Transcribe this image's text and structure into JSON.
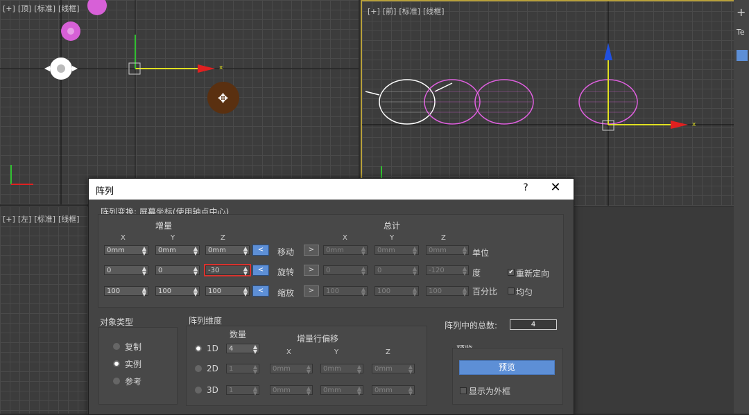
{
  "viewports": {
    "top_left": {
      "labels": [
        "[+]",
        "[顶]",
        "[标准]",
        "[线框]"
      ]
    },
    "top_right": {
      "labels": [
        "[+]",
        "[前]",
        "[标准]",
        "[线框]"
      ]
    },
    "bottom_left": {
      "labels": [
        "[+]",
        "[左]",
        "[标准]",
        "[线框]"
      ]
    }
  },
  "sidebar": {
    "text": "Te"
  },
  "dialog": {
    "title": "阵列",
    "help_label": "?",
    "close_label": "✕",
    "transform_label": "阵列变换: 屏幕坐标(使用轴点中心)",
    "increment_header": "增量",
    "total_header": "总计",
    "axes": [
      "X",
      "Y",
      "Z"
    ],
    "rows": [
      {
        "label": "移动",
        "unit": "单位",
        "inc": [
          "0mm",
          "0mm",
          "0mm"
        ],
        "tot": [
          "0mm",
          "0mm",
          "0mm"
        ]
      },
      {
        "label": "旋转",
        "unit": "度",
        "inc": [
          "0",
          "0",
          "-30"
        ],
        "tot": [
          "0",
          "0",
          "-120"
        ]
      },
      {
        "label": "缩放",
        "unit": "百分比",
        "inc": [
          "100",
          "100",
          "100"
        ],
        "tot": [
          "100",
          "100",
          "100"
        ]
      }
    ],
    "left_arrow": "<",
    "right_arrow": ">",
    "reorient": {
      "label": "重新定向",
      "checked": true
    },
    "uniform": {
      "label": "均匀",
      "checked": false
    },
    "object_type": {
      "title": "对象类型",
      "options": [
        "复制",
        "实例",
        "参考"
      ],
      "selected": "实例"
    },
    "dimensions": {
      "title": "阵列维度",
      "count_header": "数量",
      "offset_header": "增量行偏移",
      "rows": [
        {
          "label": "1D",
          "count": "4",
          "selected": true
        },
        {
          "label": "2D",
          "count": "1",
          "offsets": [
            "0mm",
            "0mm",
            "0mm"
          ]
        },
        {
          "label": "3D",
          "count": "1",
          "offsets": [
            "0mm",
            "0mm",
            "0mm"
          ]
        }
      ]
    },
    "total_in_array": {
      "label": "阵列中的总数:",
      "value": "4"
    },
    "preview": {
      "title": "预览",
      "button": "预览",
      "show_box": "显示为外框"
    }
  },
  "colors": {
    "accent": "#5d8fd6",
    "highlight": "#d9332e",
    "teapot_selected": "#e060e0"
  }
}
